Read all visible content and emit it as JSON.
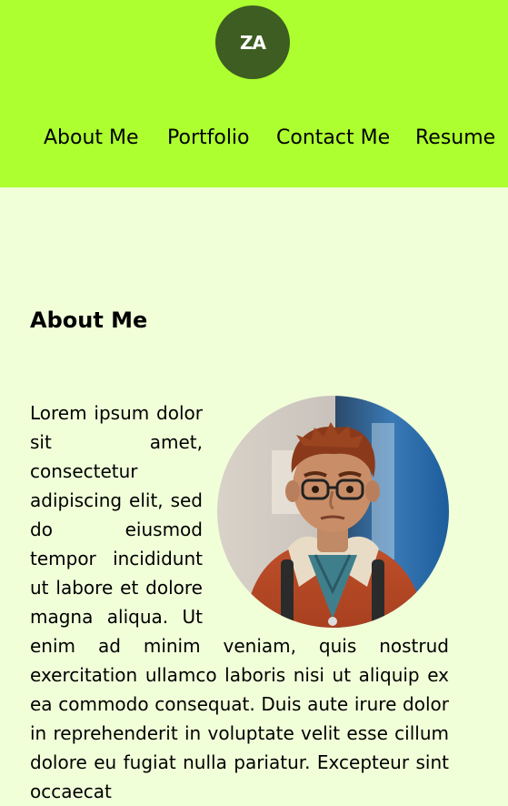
{
  "header": {
    "logo_text": "ZA",
    "nav": [
      {
        "label": "About Me"
      },
      {
        "label": "Portfolio"
      },
      {
        "label": "Contact Me"
      },
      {
        "label": "Resume"
      }
    ]
  },
  "about": {
    "heading": "About Me",
    "body": "Lorem ipsum dolor sit amet, consectetur adipiscing elit, sed do eiusmod tempor incididunt ut labore et dolore magna aliqua. Ut enim ad minim veniam, quis nostrud exercitation ullamco laboris nisi ut aliquip ex ea commodo consequat. Duis aute irure dolor in reprehenderit in voluptate velit esse cillum dolore eu fugiat nulla pariatur. Excepteur sint occaecat"
  },
  "colors": {
    "header_bg": "#adff2f",
    "page_bg": "#f1ffd9",
    "logo_bg": "#3d5d22"
  }
}
